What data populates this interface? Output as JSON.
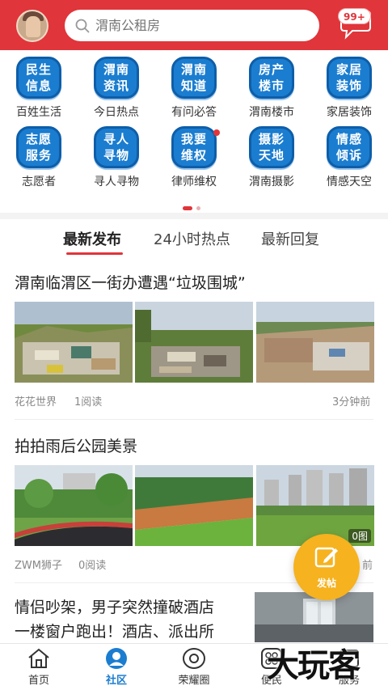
{
  "header": {
    "search_placeholder": "渭南公租房",
    "message_badge": "99+"
  },
  "categories": [
    {
      "tile": "民生\n信息",
      "label": "百姓生活"
    },
    {
      "tile": "渭南\n资讯",
      "label": "今日热点"
    },
    {
      "tile": "渭南\n知道",
      "label": "有问必答"
    },
    {
      "tile": "房产\n楼市",
      "label": "渭南楼市"
    },
    {
      "tile": "家居\n装饰",
      "label": "家居装饰"
    },
    {
      "tile": "志愿\n服务",
      "label": "志愿者"
    },
    {
      "tile": "寻人\n寻物",
      "label": "寻人寻物"
    },
    {
      "tile": "我要\n维权",
      "label": "律师维权"
    },
    {
      "tile": "摄影\n天地",
      "label": "渭南摄影"
    },
    {
      "tile": "情感\n倾诉",
      "label": "情感天空"
    }
  ],
  "tabs": [
    "最新发布",
    "24小时热点",
    "最新回复"
  ],
  "posts": [
    {
      "title": "渭南临渭区一街办遭遇“垃圾围城”",
      "author": "花花世界",
      "reads": "1阅读",
      "time": "3分钟前"
    },
    {
      "title": "拍拍雨后公园美景",
      "author": "ZWM狮子",
      "reads": "0阅读",
      "time": "前",
      "image_count": "0图"
    },
    {
      "title_line1": "情侣吵架，男子突然撞破酒店",
      "title_line2": "一楼窗户跑出！酒店、派出所"
    }
  ],
  "fab": {
    "label": "发帖"
  },
  "bottom_nav": [
    "首页",
    "社区",
    "荣耀圈",
    "便民",
    "服务"
  ],
  "watermark": "大玩客",
  "colors": {
    "brand_red": "#e0353a",
    "tile_blue": "#1b7dd0",
    "fab_orange": "#f6b21f"
  }
}
